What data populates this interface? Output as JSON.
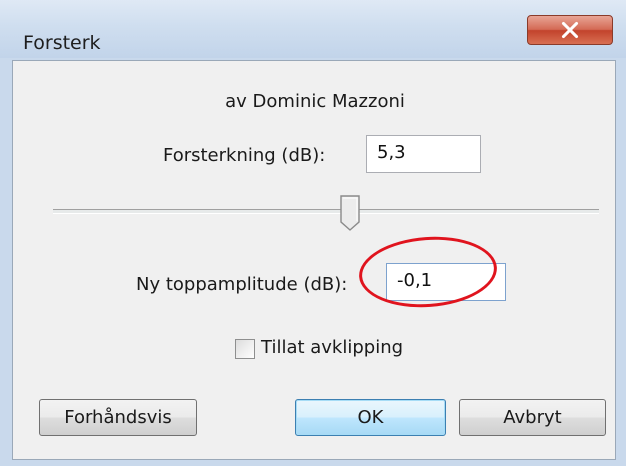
{
  "window": {
    "title": "Forsterk",
    "close_icon": "close-icon"
  },
  "author": "av Dominic Mazzoni",
  "gain": {
    "label": "Forsterkning (dB):",
    "value": "5,3"
  },
  "slider": {
    "position_fraction": 0.52
  },
  "peak": {
    "label": "Ny toppamplitude (dB):",
    "value": "-0,1"
  },
  "clipping": {
    "label": "Tillat avklipping",
    "checked": false
  },
  "buttons": {
    "preview": "Forhåndsvis",
    "ok": "OK",
    "cancel": "Avbryt"
  },
  "colors": {
    "highlight_ring": "#e0141e",
    "close_button": "#c2432c"
  }
}
